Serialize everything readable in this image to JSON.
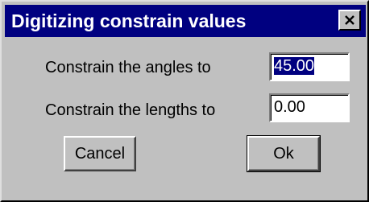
{
  "window": {
    "title": "Digitizing constrain values",
    "close_icon": "close-x-icon"
  },
  "angles": {
    "label": "Constrain the angles to",
    "value": "45.00",
    "selected": true
  },
  "lengths": {
    "label": "Constrain the lengths to",
    "value": "0.00"
  },
  "buttons": {
    "cancel_label": "Cancel",
    "ok_label": "Ok"
  },
  "colors": {
    "titlebar": "#000080",
    "face": "#c0c0c0"
  }
}
